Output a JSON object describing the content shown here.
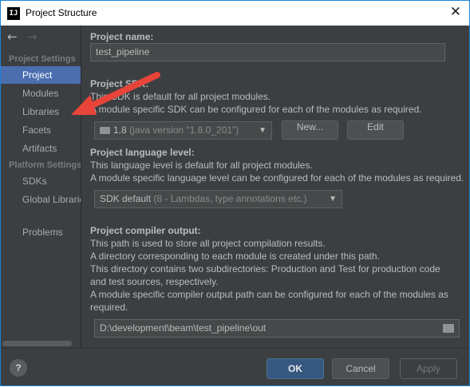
{
  "window": {
    "title": "Project Structure",
    "app_icon": "intellij-icon",
    "close_glyph": "✕"
  },
  "nav": {
    "back_glyph": "←",
    "forward_glyph": "→"
  },
  "sidebar": {
    "project_settings_header": "Project Settings",
    "project_settings_items": [
      {
        "label": "Project",
        "selected": true
      },
      {
        "label": "Modules"
      },
      {
        "label": "Libraries"
      },
      {
        "label": "Facets"
      },
      {
        "label": "Artifacts"
      }
    ],
    "platform_settings_header": "Platform Settings",
    "platform_settings_items": [
      {
        "label": "SDKs"
      },
      {
        "label": "Global Libraries"
      }
    ],
    "problems_label": "Problems"
  },
  "project_name": {
    "label": "Project name:",
    "value": "test_pipeline"
  },
  "project_sdk": {
    "label": "Project SDK:",
    "desc1": "This SDK is default for all project modules.",
    "desc2": "A module specific SDK can be configured for each of the modules as required.",
    "selected_main": "1.8",
    "selected_detail": "(java version \"1.8.0_201\")",
    "new_button": "New...",
    "edit_button": "Edit"
  },
  "language_level": {
    "label": "Project language level:",
    "desc1": "This language level is default for all project modules.",
    "desc2": "A module specific language level can be configured for each of the modules as required.",
    "selected_main": "SDK default",
    "selected_detail": "(8 - Lambdas, type annotations etc.)"
  },
  "compiler_output": {
    "label": "Project compiler output:",
    "lines": [
      "This path is used to store all project compilation results.",
      "A directory corresponding to each module is created under this path.",
      "This directory contains two subdirectories: Production and Test for production code",
      "and test sources, respectively.",
      "A module specific compiler output path can be configured for each of the modules as",
      "required."
    ],
    "path": "D:\\development\\beam\\test_pipeline\\out"
  },
  "footer": {
    "help_glyph": "?",
    "ok": "OK",
    "cancel": "Cancel",
    "apply": "Apply"
  },
  "colors": {
    "annotation_arrow": "#e8443a",
    "selection": "#4b6eaf",
    "panel_bg": "#3c3f41"
  }
}
